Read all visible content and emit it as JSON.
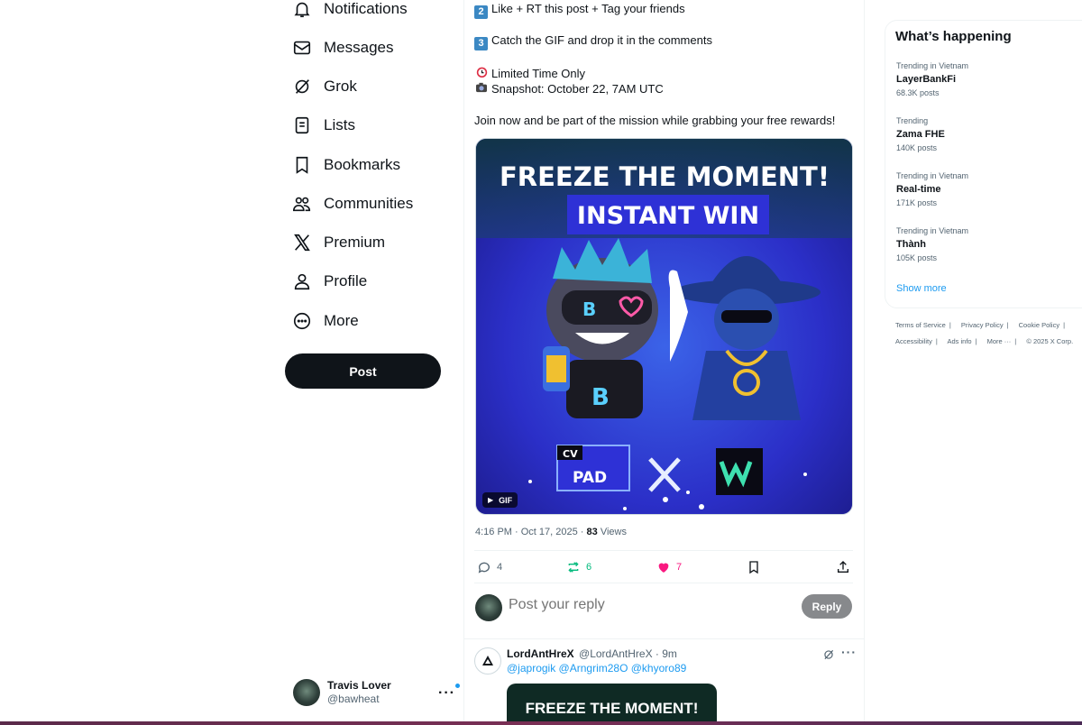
{
  "nav": {
    "items": [
      {
        "label": "Notifications",
        "icon": "bell-icon"
      },
      {
        "label": "Messages",
        "icon": "envelope-icon"
      },
      {
        "label": "Grok",
        "icon": "grok-icon"
      },
      {
        "label": "Lists",
        "icon": "list-icon"
      },
      {
        "label": "Bookmarks",
        "icon": "bookmark-icon"
      },
      {
        "label": "Communities",
        "icon": "people-icon"
      },
      {
        "label": "Premium",
        "icon": "x-logo-icon"
      },
      {
        "label": "Profile",
        "icon": "person-icon"
      },
      {
        "label": "More",
        "icon": "more-circle-icon"
      }
    ],
    "post_label": "Post",
    "account": {
      "name": "Travis Lover",
      "handle": "@bawheat"
    }
  },
  "post": {
    "step2_num": "2",
    "step2": "Like + RT this post + Tag your friends",
    "step3_num": "3",
    "step3": "Catch the GIF and drop it in the comments",
    "limited": "Limited Time Only",
    "snapshot": "Snapshot: October 22, 7AM UTC",
    "join": "Join now and be part of the mission while grabbing your free rewards!",
    "media": {
      "headline1": "FREEZE THE MOMENT!",
      "headline2": "INSTANT WIN",
      "logo_cv": "CV",
      "logo_pad": "PAD",
      "gif_badge": "GIF"
    },
    "time": "4:16 PM · Oct 17, 2025 · ",
    "views_count": "83",
    "views_label": " Views",
    "stats": {
      "replies": "4",
      "reposts": "6",
      "likes": "7"
    },
    "colors": {
      "repost": "#00ba7c",
      "like": "#f91880",
      "link": "#1d9bf0"
    }
  },
  "reply": {
    "placeholder": "Post your reply",
    "button": "Reply"
  },
  "comment": {
    "name": "LordAntHreX",
    "handle": "@LordAntHreX · 9m",
    "mentions": "@japrogik @Arngrim28O @khyoro89",
    "media_text": "FREEZE THE MOMENT!"
  },
  "trends": {
    "title": "What’s happening",
    "items": [
      {
        "context": "Trending in Vietnam",
        "topic": "LayerBankFi",
        "count": "68.3K posts"
      },
      {
        "context": "Trending",
        "topic": "Zama FHE",
        "count": "140K posts"
      },
      {
        "context": "Trending in Vietnam",
        "topic": "Real-time",
        "count": "171K posts"
      },
      {
        "context": "Trending in Vietnam",
        "topic": "Thành",
        "count": "105K posts"
      }
    ],
    "show_more": "Show more"
  },
  "footer": {
    "terms": "Terms of Service",
    "privacy": "Privacy Policy",
    "cookie": "Cookie Policy",
    "accessibility": "Accessibility",
    "ads": "Ads info",
    "more": "More ···",
    "copyright": "© 2025 X Corp."
  }
}
